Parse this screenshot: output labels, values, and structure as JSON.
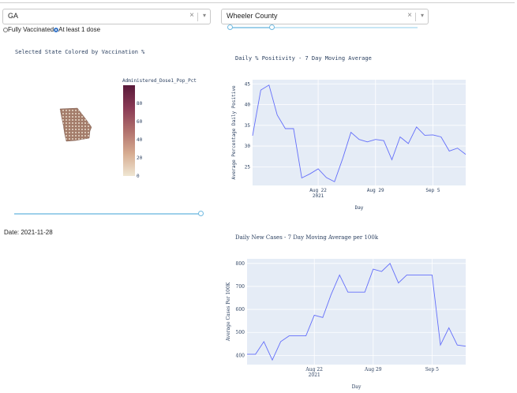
{
  "filters": {
    "state_value": "GA",
    "county_value": "Wheeler County",
    "clear_symbol": "×",
    "arrow_symbol": "▾"
  },
  "vaccine_options": [
    {
      "label": "Fully Vaccinated",
      "selected": false
    },
    {
      "label": "At least 1 dose",
      "selected": true
    }
  ],
  "map": {
    "title": "Selected State Colored by Vaccination %",
    "colorbar_title": "Administered_Dose1_Pop_Pct",
    "colorbar_ticks": [
      "80",
      "60",
      "40",
      "20",
      "0"
    ]
  },
  "date_label": "Date: 2021-11-28",
  "colors": {
    "plot_bg": "#e5ecf6",
    "line": "#636efa",
    "slider": "#9ed0ea",
    "colorbar_top": "#5a1a3a",
    "colorbar_bottom": "#efe6d2"
  },
  "chart_data": [
    {
      "type": "line",
      "title": "Daily % Positivity - 7 Day Moving Average",
      "xlabel": "Day",
      "ylabel": "Average Percentage Daily Positive",
      "ylim": [
        20.5,
        46
      ],
      "yticks": [
        "45",
        "40",
        "35",
        "30",
        "25"
      ],
      "xticks": [
        "Aug 22\n2021",
        "Aug 29",
        "Sep 5"
      ],
      "x": [
        "2021-08-14",
        "2021-08-15",
        "2021-08-16",
        "2021-08-17",
        "2021-08-18",
        "2021-08-19",
        "2021-08-20",
        "2021-08-21",
        "2021-08-22",
        "2021-08-23",
        "2021-08-24",
        "2021-08-25",
        "2021-08-26",
        "2021-08-27",
        "2021-08-28",
        "2021-08-29",
        "2021-08-30",
        "2021-08-31",
        "2021-09-01",
        "2021-09-02",
        "2021-09-03",
        "2021-09-04",
        "2021-09-05",
        "2021-09-06",
        "2021-09-07",
        "2021-09-08",
        "2021-09-09"
      ],
      "values": [
        32.5,
        43.5,
        44.7,
        37.5,
        34.2,
        34.2,
        22.3,
        23.3,
        24.5,
        22.4,
        21.4,
        27.0,
        33.3,
        31.6,
        31.0,
        31.6,
        31.3,
        26.7,
        32.2,
        30.6,
        34.6,
        32.6,
        32.7,
        32.2,
        28.8,
        29.5,
        28.0
      ]
    },
    {
      "type": "line",
      "title": "Daily New Cases - 7 Day Moving Average per 100k",
      "xlabel": "Day",
      "ylabel": "Average Cases Per 100K",
      "ylim": [
        360,
        820
      ],
      "yticks": [
        "800",
        "700",
        "600",
        "500",
        "400"
      ],
      "xticks": [
        "Aug 22\n2021",
        "Aug 29",
        "Sep 5"
      ],
      "x": [
        "2021-08-14",
        "2021-08-15",
        "2021-08-16",
        "2021-08-17",
        "2021-08-18",
        "2021-08-19",
        "2021-08-20",
        "2021-08-21",
        "2021-08-22",
        "2021-08-23",
        "2021-08-24",
        "2021-08-25",
        "2021-08-26",
        "2021-08-27",
        "2021-08-28",
        "2021-08-29",
        "2021-08-30",
        "2021-08-31",
        "2021-09-01",
        "2021-09-02",
        "2021-09-03",
        "2021-09-04",
        "2021-09-05",
        "2021-09-06",
        "2021-09-07",
        "2021-09-08",
        "2021-09-09"
      ],
      "values": [
        405,
        405,
        460,
        380,
        460,
        485,
        485,
        485,
        575,
        565,
        665,
        750,
        675,
        675,
        675,
        775,
        765,
        800,
        715,
        750,
        750,
        750,
        750,
        445,
        520,
        445,
        440
      ]
    }
  ]
}
